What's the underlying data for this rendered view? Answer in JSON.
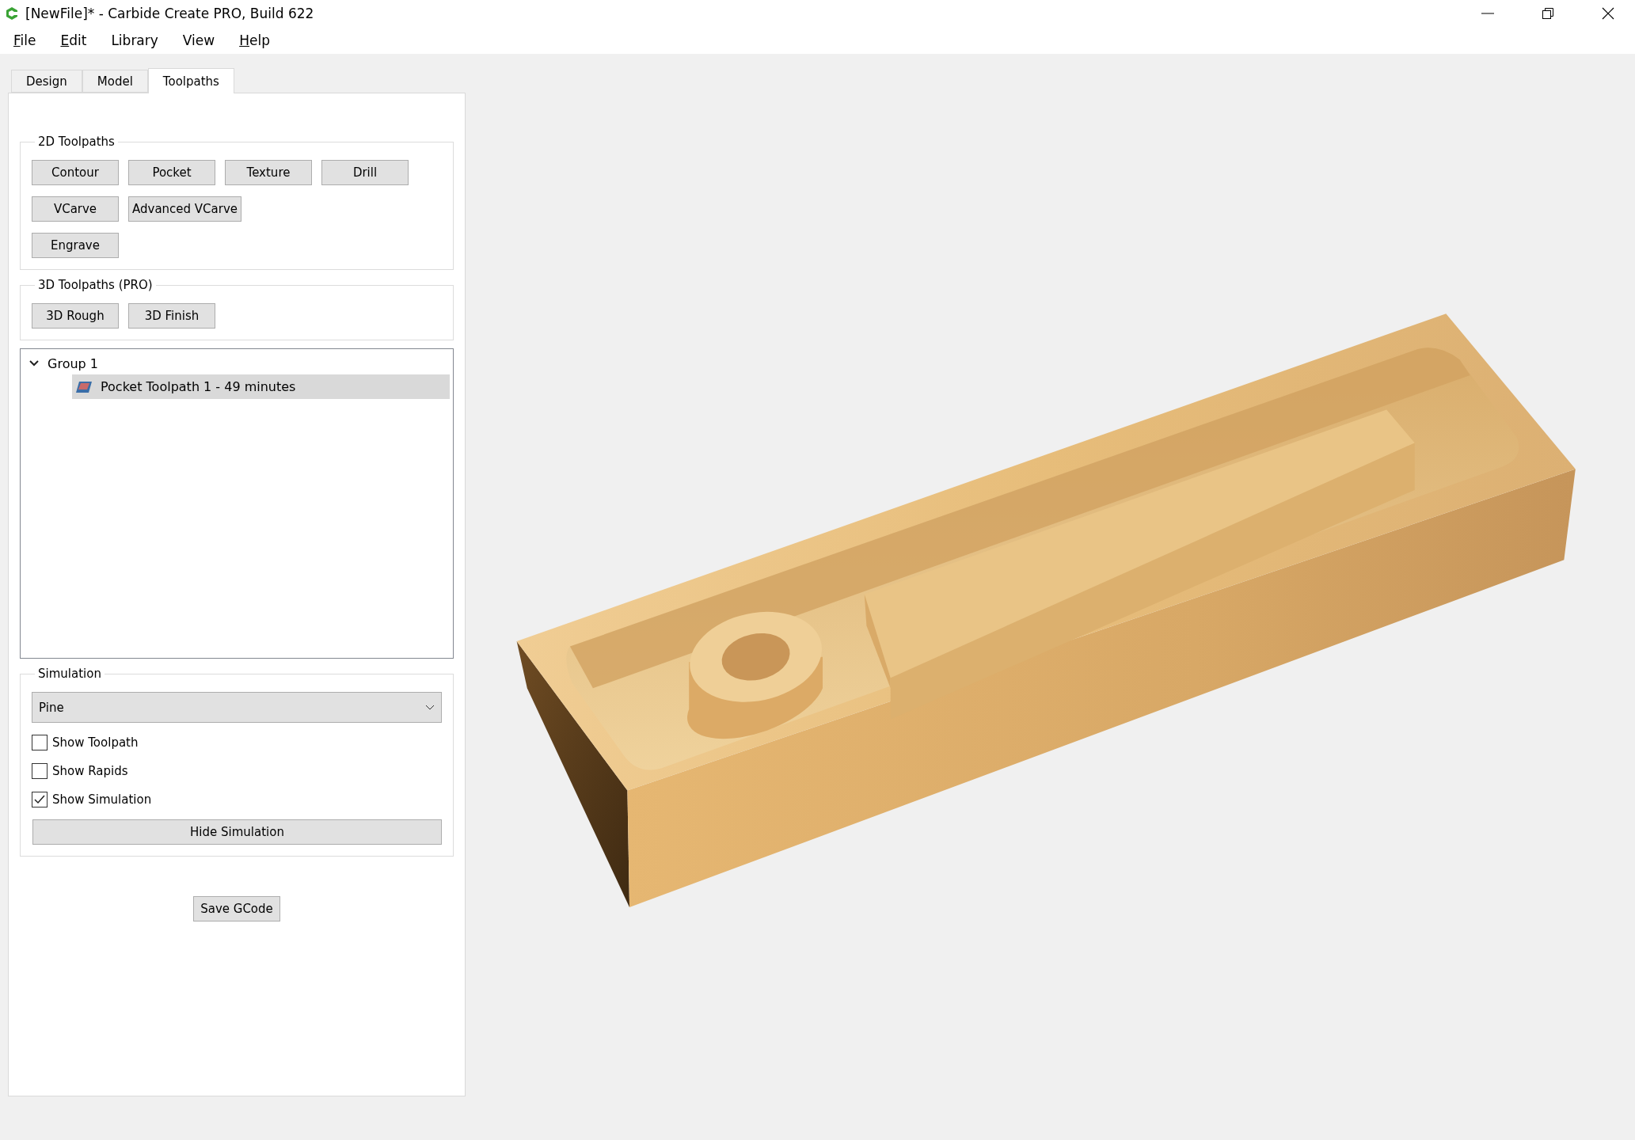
{
  "window": {
    "title": "[NewFile]* - Carbide Create PRO, Build 622"
  },
  "menu": [
    {
      "label": "File",
      "mnemonic": true
    },
    {
      "label": "Edit",
      "mnemonic": true
    },
    {
      "label": "Library",
      "mnemonic": false
    },
    {
      "label": "View",
      "mnemonic": false
    },
    {
      "label": "Help",
      "mnemonic": true
    }
  ],
  "tabs": [
    {
      "label": "Design",
      "selected": false
    },
    {
      "label": "Model",
      "selected": false
    },
    {
      "label": "Toolpaths",
      "selected": true
    }
  ],
  "toolpaths_2d": {
    "title": "2D Toolpaths",
    "rows": [
      [
        "Contour",
        "Pocket",
        "Texture",
        "Drill"
      ],
      [
        "VCarve",
        "Advanced VCarve"
      ],
      [
        "Engrave"
      ]
    ]
  },
  "toolpaths_3d": {
    "title": "3D Toolpaths (PRO)",
    "rows": [
      [
        "3D Rough",
        "3D Finish"
      ]
    ]
  },
  "tree": [
    {
      "label": "Group 1",
      "expanded": true,
      "children": [
        {
          "label": "Pocket Toolpath 1 - 49 minutes",
          "selected": true
        }
      ]
    }
  ],
  "simulation": {
    "title": "Simulation",
    "material": "Pine",
    "options": [
      {
        "label": "Show Toolpath",
        "checked": false
      },
      {
        "label": "Show Rapids",
        "checked": false
      },
      {
        "label": "Show Simulation",
        "checked": true
      }
    ],
    "button": "Hide Simulation"
  },
  "save_button": "Save GCode"
}
